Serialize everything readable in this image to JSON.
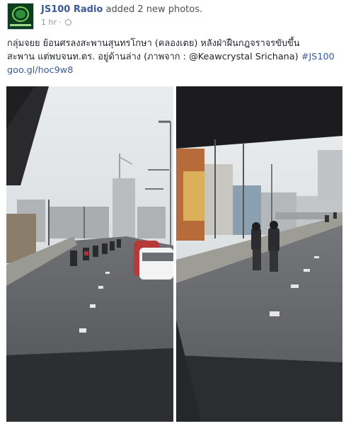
{
  "post": {
    "page_name": "JS100 Radio",
    "action_text": " added 2 new photos.",
    "timestamp": "1 hr",
    "privacy_separator": " · ",
    "privacy_icon": "globe-icon",
    "body_line1": "กลุ่มจยย ย้อนศรลงสะพานสุนทรโกษา (คลองเตย) หลังฝ่าฝืนกฎจราจรขับขึ้น",
    "body_line2_text": "สะพาน แต่พบจนท.ตร. อยู่ด้านล่าง (ภาพจาก : @Keawcrystal Srichana) ",
    "hashtag": "#JS100",
    "link": "goo.gl/hoc9w8"
  },
  "photos": [
    {
      "name": "motorcycles-wrong-way-on-bridge"
    },
    {
      "name": "two-motorcycles-on-bridge"
    }
  ],
  "colors": {
    "link": "#3b5998",
    "text": "#1d2129",
    "meta": "#90949c"
  }
}
